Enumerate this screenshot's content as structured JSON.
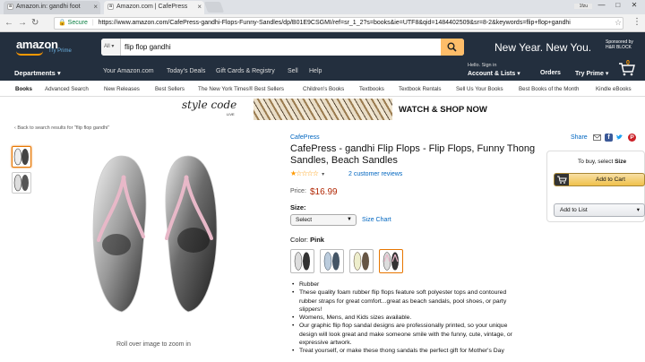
{
  "browser": {
    "tabs": [
      {
        "title": "Amazon.in: gandhi foot",
        "favicon": "a"
      },
      {
        "title": "Amazon.com | CafePress",
        "favicon": "a"
      }
    ],
    "window_user": "1fzu",
    "url_secure": "Secure",
    "url": "https://www.amazon.com/CafePress-gandhi-Flops-Funny-Sandles/dp/B01E9CSGMI/ref=sr_1_2?s=books&ie=UTF8&qid=1484402509&sr=8-2&keywords=flip+flop+gandhi"
  },
  "header": {
    "logo": "amazon",
    "try_prime_tag": "Try Prime",
    "search_dept": "All",
    "search_query": "flip flop gandhi",
    "promo": "New Year. New You.",
    "sponsor_line1": "Sponsored by",
    "sponsor_line2": "H&R BLOCK",
    "departments": "Departments",
    "links": [
      "Your Amazon.com",
      "Today's Deals",
      "Gift Cards & Registry",
      "Sell",
      "Help"
    ],
    "signin_line": "Hello. Sign in",
    "account": "Account & Lists",
    "orders": "Orders",
    "try_prime": "Try Prime",
    "cart_count": "0"
  },
  "subnav": [
    "Books",
    "Advanced Search",
    "New Releases",
    "Best Sellers",
    "The New York Times® Best Sellers",
    "Children's Books",
    "Textbooks",
    "Textbook Rentals",
    "Sell Us Your Books",
    "Best Books of the Month",
    "Kindle eBooks"
  ],
  "banner": {
    "logo": "style code",
    "logo_sub": "LIVE",
    "cta": "WATCH & SHOP NOW"
  },
  "product": {
    "back_link": "‹ Back to search results for \"flip flop gandhi\"",
    "brand": "CafePress",
    "title": "CafePress - gandhi Flip Flops - Flip Flops, Funny Thong Sandles, Beach Sandles",
    "stars": "★☆☆☆☆",
    "star_caret": "▾",
    "reviews": "2 customer reviews",
    "price_label": "Price:",
    "price": "$16.99",
    "size_label": "Size:",
    "size_select": "Select",
    "size_chart": "Size Chart",
    "color_label": "Color:",
    "color_value": "Pink",
    "zoom_hint": "Roll over image to zoom in",
    "bullets": [
      "Rubber",
      "These quality foam rubber flip flops feature soft polyester tops and contoured rubber straps for great comfort...great as beach sandals, pool shoes, or party slippers!",
      "Womens, Mens, and Kids sizes available.",
      "Our graphic flip flop sandal designs are professionally printed, so your unique design will look great and make someone smile with the funny, cute, vintage, or expressive artwork.",
      "Treat yourself, or make these thong sandals the perfect gift for Mother's Day"
    ],
    "colors": {
      "strap_pink": "#e8b8c8",
      "accent": "#e77600",
      "price": "#b12704",
      "link": "#0066c0"
    }
  },
  "buybox": {
    "share": "Share",
    "to_buy_prefix": "To buy, select",
    "to_buy_bold": "Size",
    "add_to_cart": "Add to Cart",
    "add_to_list": "Add to List"
  }
}
